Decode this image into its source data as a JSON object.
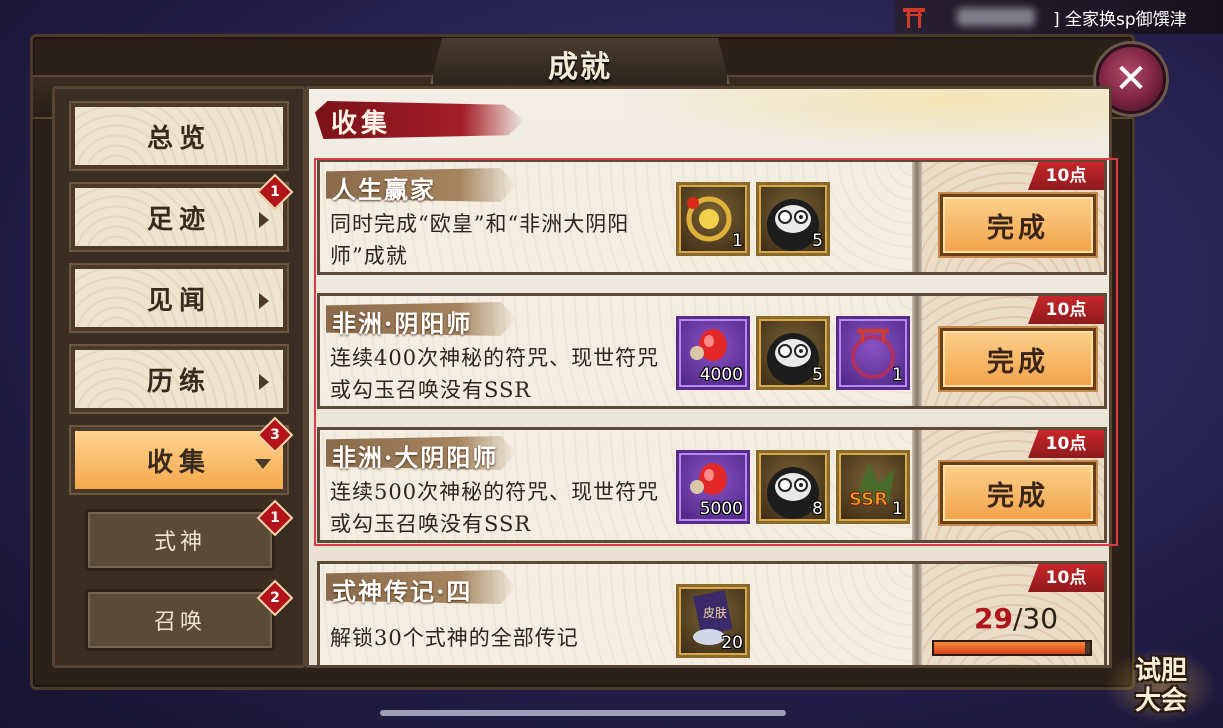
{
  "banner": {
    "text": "] 全家换sp御馔津"
  },
  "title": "成就",
  "sidebar": {
    "items": [
      {
        "label": "总览",
        "badge": ""
      },
      {
        "label": "足迹",
        "badge": "1"
      },
      {
        "label": "见闻",
        "badge": ""
      },
      {
        "label": "历练",
        "badge": ""
      },
      {
        "label": "收集",
        "badge": "3"
      }
    ],
    "subitems": [
      {
        "label": "式神",
        "badge": "1"
      },
      {
        "label": "召唤",
        "badge": "2"
      }
    ]
  },
  "section_title": "收集",
  "achievements": [
    {
      "title": "人生赢家",
      "desc": "同时完成“欧皇”和“非洲大阴阳师”成就",
      "points": "10点",
      "button": "完成",
      "rewards": [
        {
          "icon": "fortune-charm-icon",
          "count": "1"
        },
        {
          "icon": "daruma-icon",
          "count": "5"
        }
      ]
    },
    {
      "title": "非洲·阴阳师",
      "desc": "连续400次神秘的符咒、现世符咒或勾玉召唤没有SSR",
      "points": "10点",
      "button": "完成",
      "rewards": [
        {
          "icon": "jade-icon",
          "count": "4000"
        },
        {
          "icon": "daruma-icon",
          "count": "5"
        },
        {
          "icon": "torii-frame-icon",
          "count": "1"
        }
      ]
    },
    {
      "title": "非洲·大阴阳师",
      "desc": "连续500次神秘的符咒、现世符咒或勾玉召唤没有SSR",
      "points": "10点",
      "button": "完成",
      "rewards": [
        {
          "icon": "jade-icon",
          "count": "5000"
        },
        {
          "icon": "daruma-icon",
          "count": "8"
        },
        {
          "icon": "ssr-token-icon",
          "count": "1"
        }
      ]
    },
    {
      "title": "式神传记·四",
      "desc": "解锁30个式神的全部传记",
      "points": "10点",
      "progress": {
        "current": "29",
        "max": "/30",
        "fraction": 0.967
      },
      "rewards": [
        {
          "icon": "skin-scroll-icon",
          "count": "20"
        }
      ]
    }
  ],
  "event_logo": {
    "line1": "试胆",
    "line2": "大会"
  }
}
